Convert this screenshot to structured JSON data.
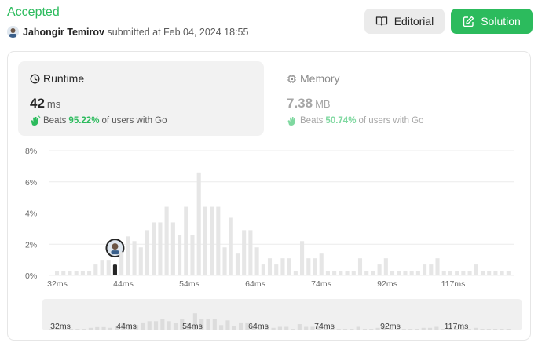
{
  "header": {
    "status": "Accepted",
    "submitter_name": "Jahongir Temirov",
    "submitted_text": "submitted at Feb 04, 2024 18:55",
    "editorial_label": "Editorial",
    "solution_label": "Solution"
  },
  "runtime": {
    "title": "Runtime",
    "value": "42",
    "unit": "ms",
    "beats_label": "Beats",
    "beats_pct": "95.22%",
    "beats_suffix": "of users with Go"
  },
  "memory": {
    "title": "Memory",
    "value": "7.38",
    "unit": "MB",
    "beats_label": "Beats",
    "beats_pct": "50.74%",
    "beats_suffix": "of users with Go"
  },
  "colors": {
    "accent_green": "#2cbb5d",
    "bar_gray": "#e6e6e6",
    "user_bar": "#262626"
  },
  "chart_data": {
    "type": "bar",
    "y_ticks": [
      "8%",
      "6%",
      "4%",
      "2%",
      "0%"
    ],
    "x_ticks": [
      "32ms",
      "44ms",
      "54ms",
      "64ms",
      "74ms",
      "92ms",
      "117ms"
    ],
    "ylim": [
      0,
      8
    ],
    "values": [
      0.3,
      0.3,
      0.3,
      0.3,
      0.3,
      0.3,
      0.7,
      1.0,
      1.0,
      0.7,
      1.5,
      2.5,
      2.2,
      1.8,
      2.9,
      3.4,
      3.4,
      4.4,
      3.4,
      2.6,
      4.4,
      2.6,
      6.6,
      4.4,
      4.4,
      4.4,
      1.8,
      3.7,
      1.4,
      2.9,
      2.9,
      1.8,
      0.7,
      1.1,
      0.7,
      1.1,
      1.1,
      0.3,
      2.2,
      1.1,
      1.1,
      1.4,
      0.3,
      0.3,
      0.3,
      0.3,
      0.3,
      1.1,
      0.3,
      0.3,
      0.7,
      1.1,
      0.3,
      0.3,
      0.3,
      0.3,
      0.3,
      0.7,
      0.7,
      1.1,
      0.3,
      0.3,
      0.3,
      0.3,
      0.3,
      0.7,
      0.3,
      0.3,
      0.3,
      0.3,
      0.3
    ],
    "user_bar_index": 9,
    "user_value": 0.7,
    "icons": [
      "clock-icon",
      "chip-icon",
      "clapping-hands-icon",
      "book-icon",
      "edit-icon"
    ]
  }
}
